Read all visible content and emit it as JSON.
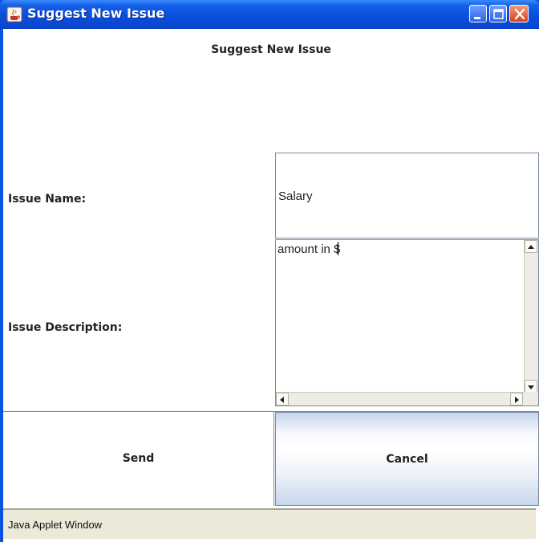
{
  "window": {
    "title": "Suggest New Issue",
    "title_color": "#ffffff",
    "titlebar_color": "#0a4edb"
  },
  "form": {
    "heading": "Suggest New Issue",
    "issue_name_label": "Issue Name:",
    "issue_name_value": "Salary",
    "issue_description_label": "Issue Description:",
    "issue_description_value": "amount in $"
  },
  "buttons": {
    "send_label": "Send",
    "cancel_label": "Cancel"
  },
  "status": {
    "text": "Java Applet Window"
  }
}
